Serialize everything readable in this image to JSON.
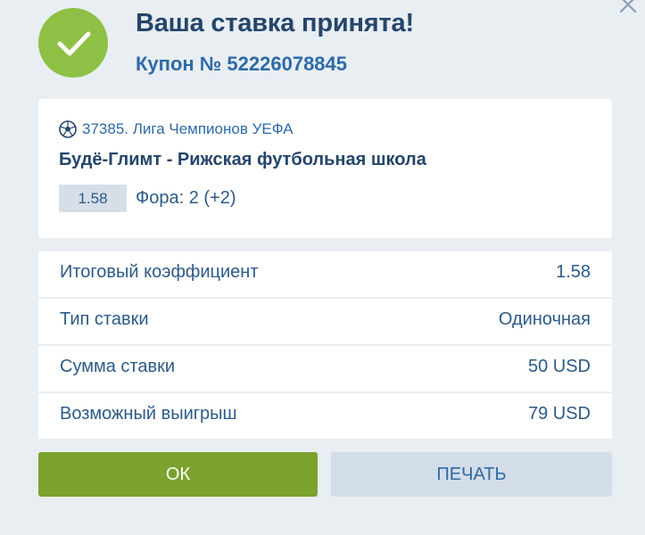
{
  "header": {
    "title": "Ваша ставка принята!",
    "coupon": "Купон № 52226078845",
    "close_icon": "close-icon",
    "success_icon": "checkmark-circle-icon",
    "success_color": "#8ec045"
  },
  "event": {
    "sport_icon": "soccer-ball-icon",
    "league": "37385. Лига Чемпионов УЕФА",
    "match": "Будё-Глимт - Рижская футбольная школа",
    "odds": "1.58",
    "market": "Фора: 2 (+2)"
  },
  "summary": {
    "rows": [
      {
        "label": "Итоговый коэффициент",
        "value": "1.58"
      },
      {
        "label": "Тип ставки",
        "value": "Одиночная"
      },
      {
        "label": "Сумма ставки",
        "value": "50 USD"
      },
      {
        "label": "Возможный выигрыш",
        "value": "79 USD"
      }
    ]
  },
  "buttons": {
    "ok_label": "ОК",
    "print_label": "ПЕЧАТЬ",
    "ok_color": "#7aa22d",
    "print_color": "#d3dde7"
  }
}
